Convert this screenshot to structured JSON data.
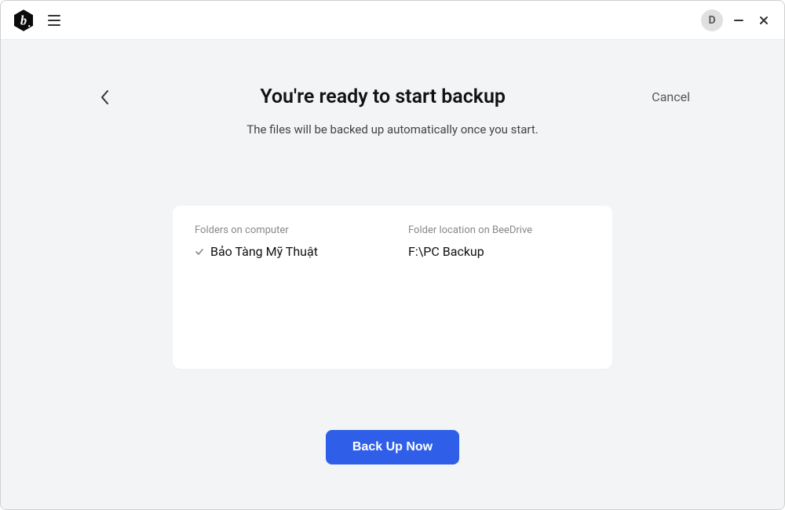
{
  "titlebar": {
    "avatar_initial": "D"
  },
  "header": {
    "title": "You're ready to start backup",
    "subtitle": "The files will be backed up automatically once you start.",
    "cancel_label": "Cancel"
  },
  "summary": {
    "source_label": "Folders on computer",
    "destination_label": "Folder location on BeeDrive",
    "source_folder": "Bảo Tàng Mỹ Thuật",
    "destination_path": "F:\\PC Backup"
  },
  "actions": {
    "primary_label": "Back Up Now"
  }
}
